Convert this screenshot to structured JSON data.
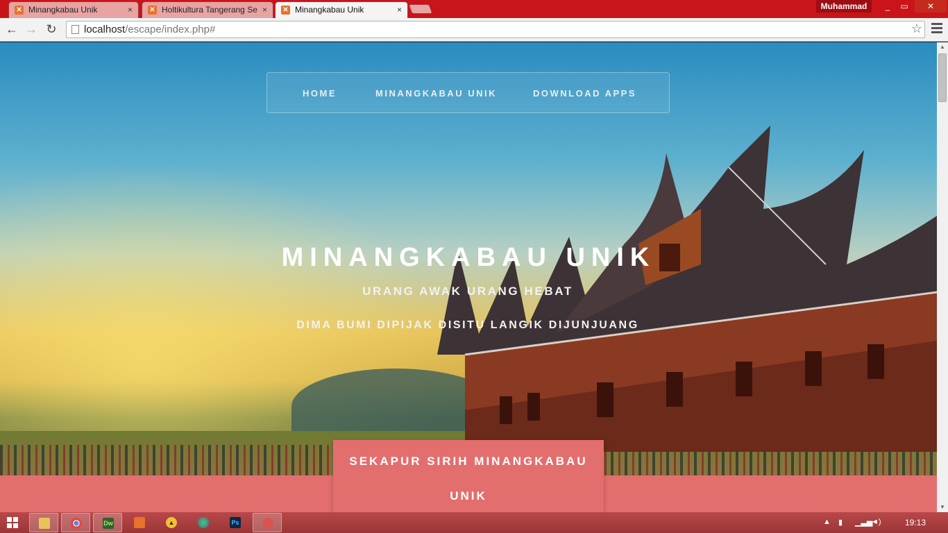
{
  "browser": {
    "tabs": [
      {
        "title": "Minangkabau Unik",
        "active": false
      },
      {
        "title": "Holtikultura Tangerang Se",
        "active": false
      },
      {
        "title": "Minangkabau Unik",
        "active": true
      }
    ],
    "user": "Muhammad",
    "close_glyph": "×",
    "url_host": "localhost",
    "url_path": "/escape/index.php#",
    "back": "←",
    "forward": "→",
    "reload": "↻",
    "star": "☆",
    "minimize": "_",
    "maximize": "▭",
    "close": "✕"
  },
  "page": {
    "nav": {
      "home": "HOME",
      "minangkabau": "MINANGKABAU UNIK",
      "download": "DOWNLOAD APPS"
    },
    "hero": {
      "title": "MINANGKABAU UNIK",
      "subtitle1": "URANG AWAK URANG HEBAT",
      "subtitle2": "DIMA BUMI DIPIJAK DISITU LANGIK DIJUNJUANG"
    },
    "cta": {
      "line1": "SEKAPUR SIRIH MINANGKABAU",
      "line2": "UNIK"
    },
    "colors": {
      "accent": "#e36e6e",
      "titlebar": "#c9141a"
    }
  },
  "taskbar": {
    "items": [
      {
        "name": "file-explorer-icon",
        "label": ""
      },
      {
        "name": "chrome-icon",
        "label": ""
      },
      {
        "name": "dreamweaver-icon",
        "label": "Dw"
      },
      {
        "name": "xampp-icon",
        "label": ""
      },
      {
        "name": "app-icon",
        "label": ""
      },
      {
        "name": "globe-icon",
        "label": ""
      },
      {
        "name": "photoshop-icon",
        "label": "Ps"
      },
      {
        "name": "app-icon-2",
        "label": ""
      }
    ],
    "clock": "19:13"
  }
}
